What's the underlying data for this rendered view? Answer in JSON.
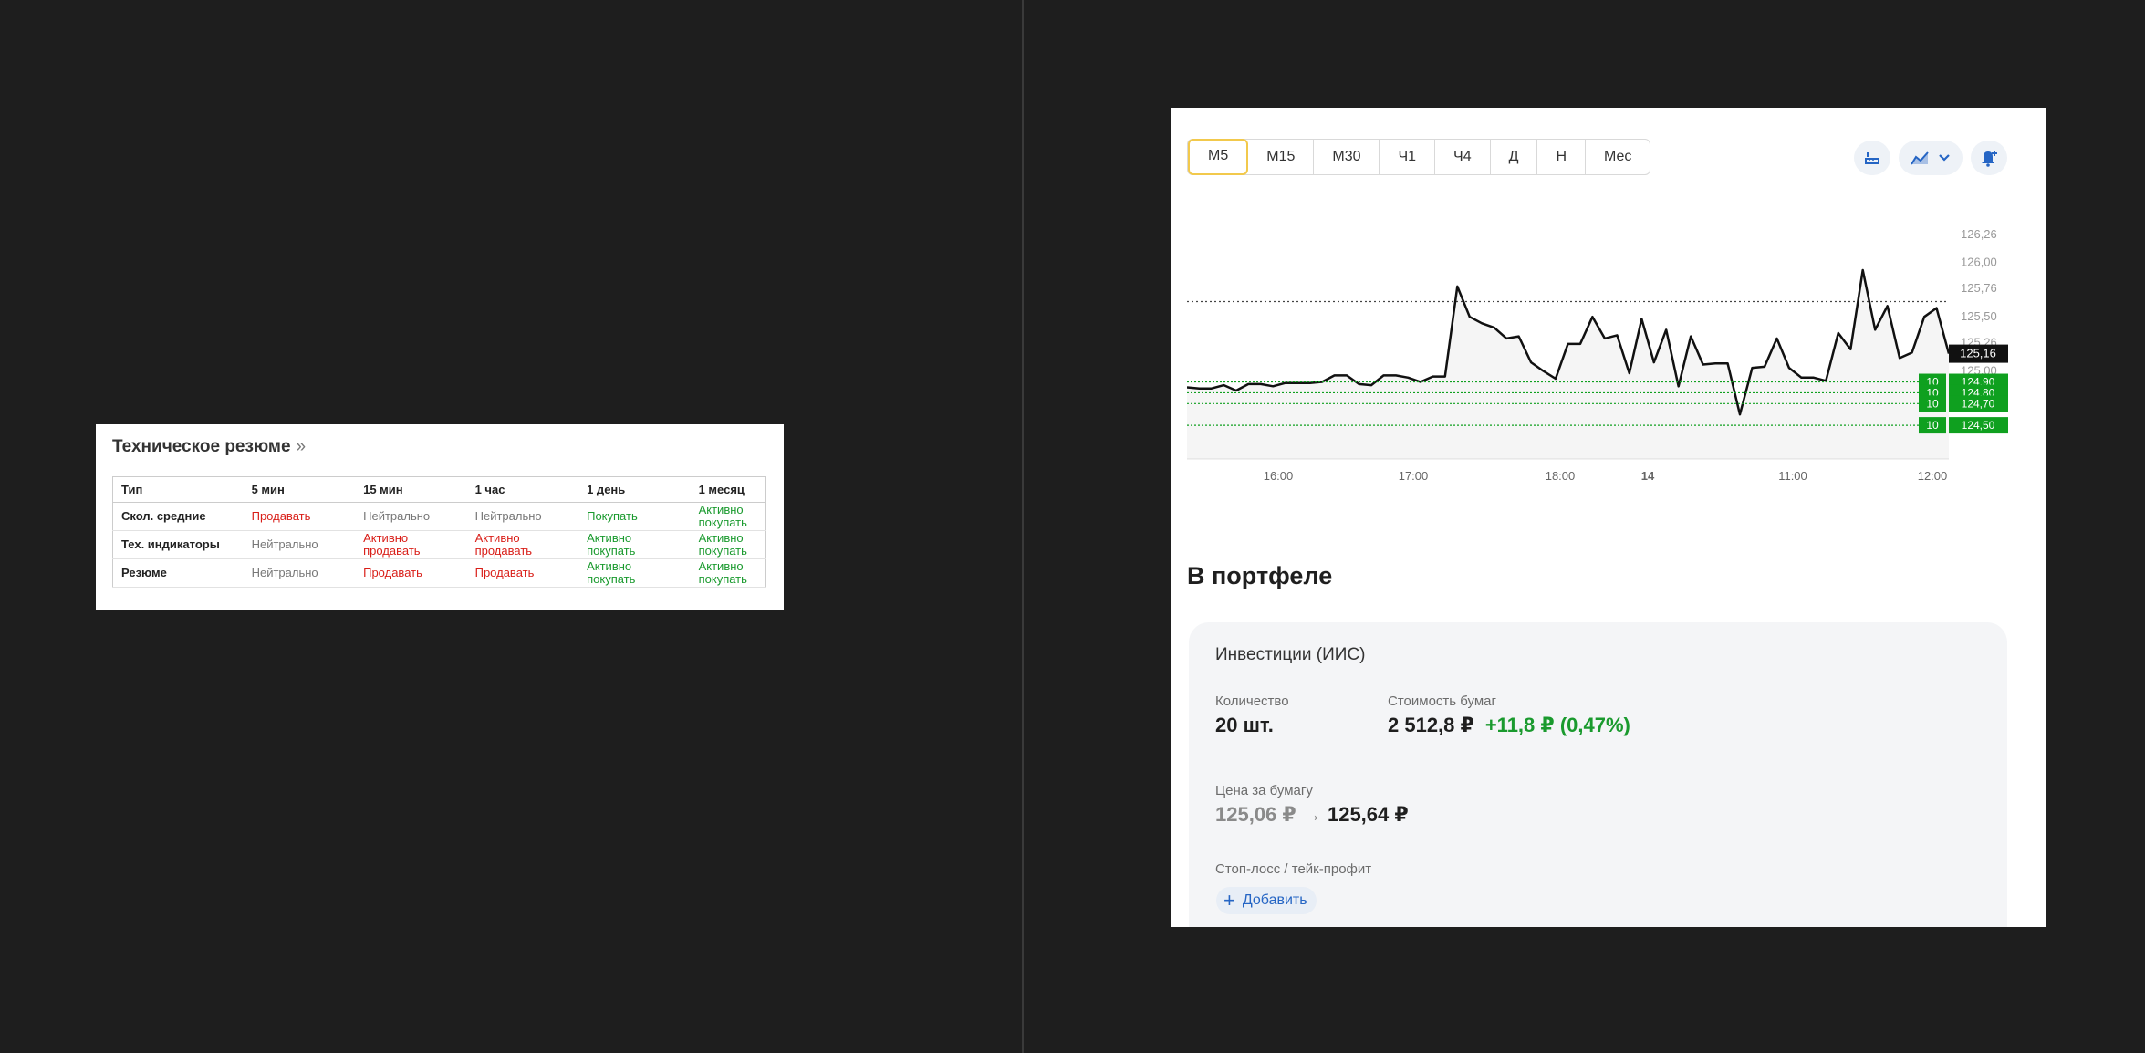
{
  "tech_summary": {
    "title": "Техническое резюме",
    "title_arrow": "»",
    "headers": [
      "Тип",
      "5 мин",
      "15 мин",
      "1 час",
      "1 день",
      "1 месяц"
    ],
    "rows": [
      {
        "type": "Скол. средние",
        "cells": [
          {
            "text": "Продавать",
            "status": "sell"
          },
          {
            "text": "Нейтрально",
            "status": "neutral"
          },
          {
            "text": "Нейтрально",
            "status": "neutral"
          },
          {
            "text": "Покупать",
            "status": "buy"
          },
          {
            "text": "Активно покупать",
            "status": "buy"
          }
        ]
      },
      {
        "type": "Тех. индикаторы",
        "cells": [
          {
            "text": "Нейтрально",
            "status": "neutral"
          },
          {
            "text": "Активно продавать",
            "status": "sell"
          },
          {
            "text": "Активно продавать",
            "status": "sell"
          },
          {
            "text": "Активно покупать",
            "status": "buy"
          },
          {
            "text": "Активно покупать",
            "status": "buy"
          }
        ]
      },
      {
        "type": "Резюме",
        "cells": [
          {
            "text": "Нейтрально",
            "status": "neutral"
          },
          {
            "text": "Продавать",
            "status": "sell"
          },
          {
            "text": "Продавать",
            "status": "sell"
          },
          {
            "text": "Активно покупать",
            "status": "buy"
          },
          {
            "text": "Активно покупать",
            "status": "buy"
          }
        ]
      }
    ]
  },
  "colors": {
    "sell": "#d91e18",
    "buy": "#1a9a2e",
    "neutral": "#777777",
    "accent": "#f2c94c",
    "order": "#0fa01f"
  },
  "trading": {
    "timeframes": [
      "М5",
      "М15",
      "М30",
      "Ч1",
      "Ч4",
      "Д",
      "Н",
      "Мес"
    ],
    "active_timeframe": "М5",
    "icons": [
      "ruler-icon",
      "chart-type-icon",
      "chevron-down-icon",
      "bell-plus-icon"
    ]
  },
  "chart_data": {
    "type": "line",
    "x_labels": [
      "16:00",
      "17:00",
      "18:00",
      "14",
      "11:00",
      "12:00"
    ],
    "y_ticks": [
      "126,26",
      "126,00",
      "125,76",
      "125,50",
      "125,26",
      "125,00"
    ],
    "ylim": [
      124.4,
      126.3
    ],
    "values": [
      124.85,
      124.84,
      124.84,
      124.87,
      124.82,
      124.88,
      124.88,
      124.86,
      124.89,
      124.89,
      124.89,
      124.9,
      124.96,
      124.96,
      124.88,
      124.87,
      124.96,
      124.96,
      124.94,
      124.9,
      124.95,
      124.95,
      125.78,
      125.5,
      125.44,
      125.4,
      125.3,
      125.32,
      125.08,
      125.0,
      124.93,
      125.25,
      125.25,
      125.5,
      125.3,
      125.33,
      124.98,
      125.48,
      125.08,
      125.38,
      124.86,
      125.32,
      125.06,
      125.07,
      125.07,
      124.6,
      125.03,
      125.04,
      125.3,
      125.03,
      124.94,
      124.94,
      124.91,
      125.35,
      125.2,
      125.93,
      125.38,
      125.6,
      125.12,
      125.17,
      125.5,
      125.58,
      125.16
    ],
    "current_price": "125,16",
    "dotted_level": 125.64,
    "orders": [
      {
        "qty": "10",
        "price": "124,90",
        "value": 124.9
      },
      {
        "qty": "10",
        "price": "124,80",
        "value": 124.8
      },
      {
        "qty": "10",
        "price": "124,70",
        "value": 124.7
      },
      {
        "qty": "10",
        "price": "124,50",
        "value": 124.5
      }
    ]
  },
  "portfolio": {
    "heading": "В портфеле",
    "account": "Инвестиции (ИИС)",
    "qty_label": "Количество",
    "qty_value": "20 шт.",
    "cost_label": "Стоимость бумаг",
    "cost_value": "2 512,8 ₽",
    "cost_change": "+11,8 ₽ (0,47%)",
    "price_label": "Цена за бумагу",
    "price_old": "125,06 ₽",
    "price_arrow": "→",
    "price_new": "125,64 ₽",
    "stop_label": "Стоп-лосс / тейк-профит",
    "add_plus": "+",
    "add_label": "Добавить"
  }
}
